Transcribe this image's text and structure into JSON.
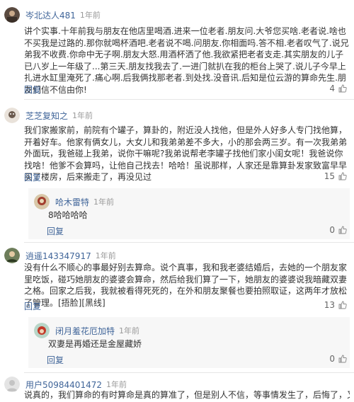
{
  "comments": [
    {
      "user": "岑北达人481",
      "time": "1年前",
      "text": "讲个实事.十年前我与朋友在他店里喝酒.进来一位老者.朋友问.大爷您买啥.老者说.啥也不买我是过路的.那你就喝杯酒吧.老者说不喝.问朋友.你相面吗.答不相.老者叹气了.说兄弟我不收费.你命中无子啊.朋友大怒.用酒杯洒了他.我欲紧把老者支走.其实朋友的儿子已八岁上一年级了...第三天.朋友找我去了.一进门就扒在我的柜台上哭了.说儿子今早上扎进水缸里淹死了.痛心啊.后我俩找那老者.到处找.没音讯.后知是位云游的算命先生.朋友们信不信由你!",
      "reply_label": "回复",
      "likes": "4"
    },
    {
      "user": "芝芝复知之",
      "time": "1年前",
      "text": "我们家搬家前，前院有个罐子，算卦的，附近没人找他，但是外人好多人专门找他算，开着好车。他家有俩女儿，大女儿和我弟弟差不多大，小的那会两三岁。有一次我弟弟外面玩，我爸碰上我弟，说你干嘛呢?我弟说帮老李罐子找他们家小闺女呢！我爸说你找啥！他爹不会算吗，让他自己找去！哈哈！虽说那样，人家还是靠算卦发家致富早早买了楼房，后来搬走了，再没见过",
      "reply_label": "回复",
      "likes": "15",
      "sub": {
        "user": "哈木雷特",
        "time": "1年前",
        "text": "8哈哈哈哈",
        "reply_label": "回复",
        "likes": "0"
      }
    },
    {
      "user": "逍遥143347917",
      "time": "1年前",
      "text": "没有什么不顺心的事最好别去算命。说个真事，我和我老婆结婚后，去她的一个朋友家里吃饭，碰巧她朋友的婆婆会算命，然后给我们算了一下，她朋友的婆婆说我暗藏双妻之格。回家之后我，我就被看得死死的，在外和朋友聚餐也要拍照取证，这两年才放松了管理。[捂脸][黑线]",
      "reply_label": "回复",
      "likes": "13",
      "sub": {
        "user": "闭月羞花厄加特",
        "time": "1年前",
        "text": "双妻是再婚还是金屋藏娇",
        "reply_label": "回复",
        "likes": "0"
      }
    },
    {
      "user": "用户50984401472",
      "time": "1年前",
      "text": "说真的，我们算命的有时算命是真的算准了，但是别人不信，等事情发生了，后悔了，又迟了，我就"
    }
  ],
  "colors": {
    "username": "#406599",
    "time": "#999999",
    "text": "#333333",
    "sub_bg": "#f7f7f7"
  },
  "icons": {
    "like": "thumb-up-icon"
  }
}
